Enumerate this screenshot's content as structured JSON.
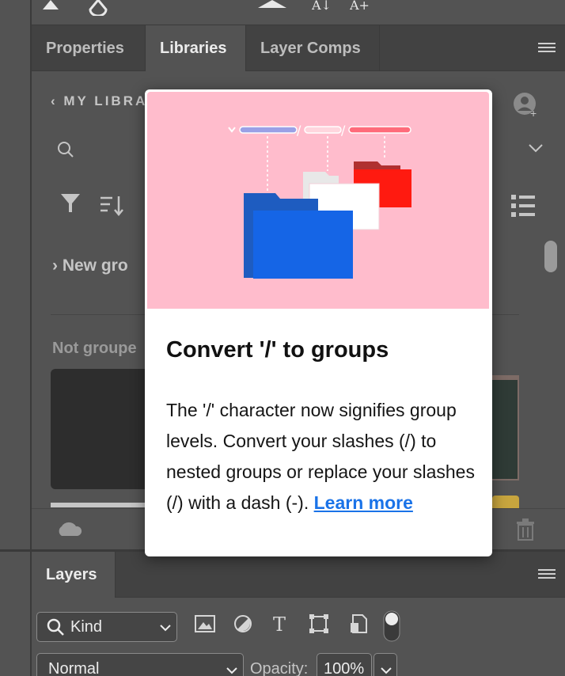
{
  "libraries_panel": {
    "tabs": [
      {
        "label": "Properties",
        "active": false
      },
      {
        "label": "Libraries",
        "active": true
      },
      {
        "label": "Layer Comps",
        "active": false
      }
    ],
    "library_name_truncated": "MY LIBRA",
    "group_row_truncated": "New gro",
    "section_truncated": "Not groupe"
  },
  "popover": {
    "title": "Convert '/' to groups",
    "body": "The '/' character now signifies group levels. Convert your slashes (/) to nested groups or replace your slashes (/) with a dash (-). ",
    "link_label": "Learn more",
    "hero_background": "#ffbccc"
  },
  "layers_panel": {
    "tab_label": "Layers",
    "filter_kind": "Kind",
    "blend_mode": "Normal",
    "opacity_label": "Opacity:",
    "opacity_value": "100%"
  },
  "colors": {
    "panel_bg": "#535353",
    "tabbar_bg": "#424242",
    "link": "#1a73e8"
  }
}
